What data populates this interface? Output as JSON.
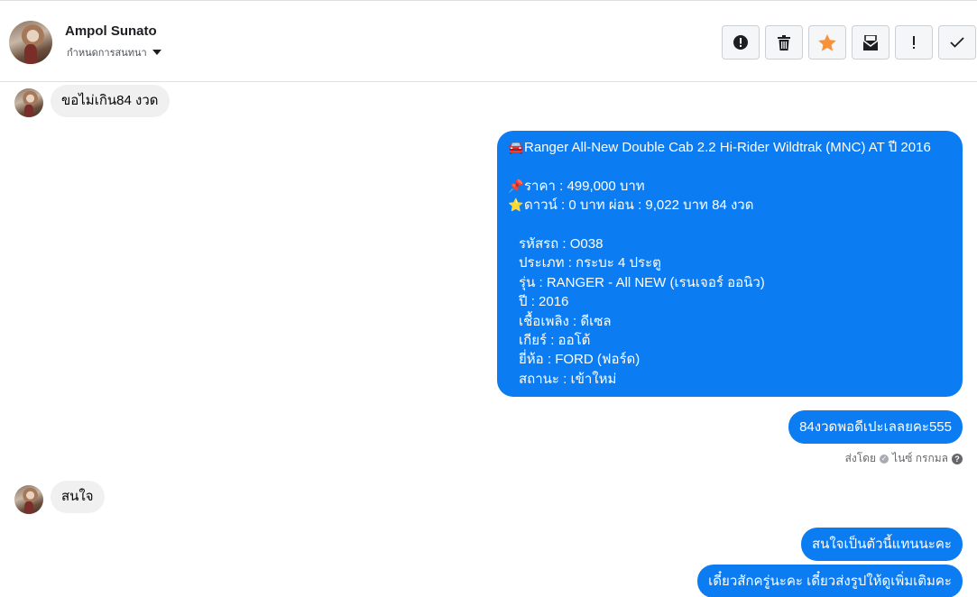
{
  "header": {
    "name": "Ampol Sunato",
    "subtitle": "กำหนดการสนทนา",
    "actions": [
      {
        "name": "report-icon",
        "label": "Report"
      },
      {
        "name": "trash-icon",
        "label": "Delete"
      },
      {
        "name": "star-icon",
        "label": "Star",
        "color": "#f7923b"
      },
      {
        "name": "mark-unread-icon",
        "label": "Mark as unread"
      },
      {
        "name": "exclamation-icon",
        "label": "Mark as spam"
      },
      {
        "name": "checkmark-icon",
        "label": "Done"
      }
    ]
  },
  "colors": {
    "outgoing_bubble": "#0b7cf1",
    "incoming_bubble": "#f0f0f0"
  },
  "messages": {
    "m1": {
      "direction": "incoming",
      "text": "ขอไม่เกิน84 งวด"
    },
    "m2": {
      "direction": "outgoing",
      "title_emoji": "🚘",
      "title": "Ranger All-New Double Cab 2.2 Hi-Rider Wildtrak (MNC) AT ปี 2016",
      "price_emoji": "📌",
      "price": "ราคา : 499,000 บาท",
      "down_emoji": "⭐",
      "down": "ดาวน์ : 0 บาท ผ่อน : 9,022 บาท 84 งวด",
      "code": "รหัสรถ : O038",
      "type": "ประเภท : กระบะ 4 ประตู",
      "model": "รุ่น : RANGER - All NEW (เรนเจอร์ ออนิว)",
      "year": "ปี : 2016",
      "fuel": "เชื้อเพลิง : ดีเซล",
      "gear": "เกียร์ : ออโต้",
      "brand": "ยี่ห้อ : FORD (ฟอร์ด)",
      "status": "สถานะ : เข้าใหม่"
    },
    "m3": {
      "direction": "outgoing",
      "text": "84งวดพอดีเปะเลลยคะ555"
    },
    "sent_by": {
      "prefix": "ส่งโดย",
      "name": "ไนซ์ กรกมล",
      "help": "?"
    },
    "m4": {
      "direction": "incoming",
      "text": "สนใจ"
    },
    "m5": {
      "direction": "outgoing",
      "text": "สนใจเป็นตัวนี้แทนนะคะ"
    },
    "m6": {
      "direction": "outgoing",
      "text": "เดี๋ยวสักครู่นะคะ เดี๋ยวส่งรูปให้ดูเพิ่มเติมคะ"
    }
  }
}
